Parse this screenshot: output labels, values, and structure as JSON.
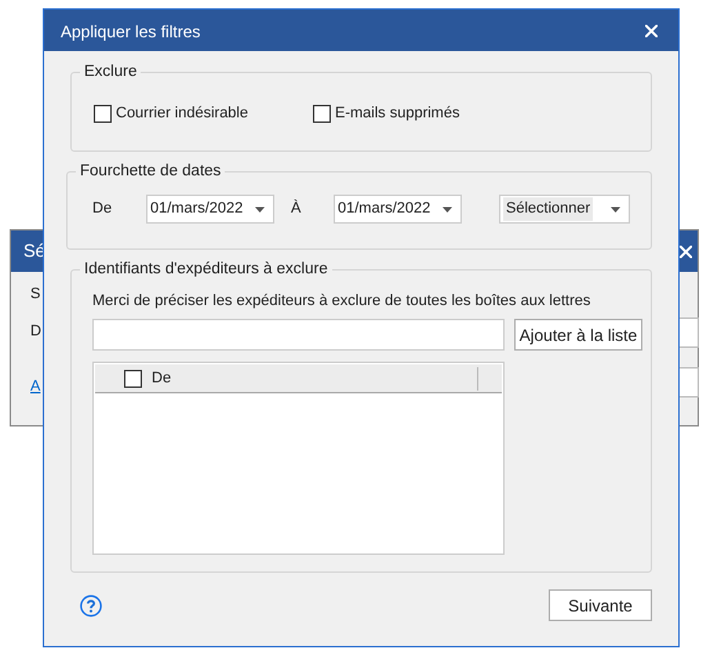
{
  "background_window": {
    "title": "Sé",
    "labels": [
      "S",
      "D"
    ],
    "link": "A"
  },
  "dialog": {
    "title": "Appliquer les filtres",
    "exclude": {
      "legend": "Exclure",
      "options": [
        {
          "label": "Courrier indésirable",
          "checked": false
        },
        {
          "label": "E-mails supprimés",
          "checked": false
        }
      ]
    },
    "date_range": {
      "legend": "Fourchette de dates",
      "from_label": "De",
      "from_value": "01/mars/2022",
      "to_label": "À",
      "to_value": "01/mars/2022",
      "preset": "Sélectionner"
    },
    "senders": {
      "legend": "Identifiants d'expéditeurs à exclure",
      "instruction": "Merci de préciser les expéditeurs à exclure de toutes les boîtes aux lettres",
      "add_button": "Ajouter à la liste",
      "list": {
        "column": "De",
        "checked": false
      }
    },
    "next_button": "Suivante"
  }
}
